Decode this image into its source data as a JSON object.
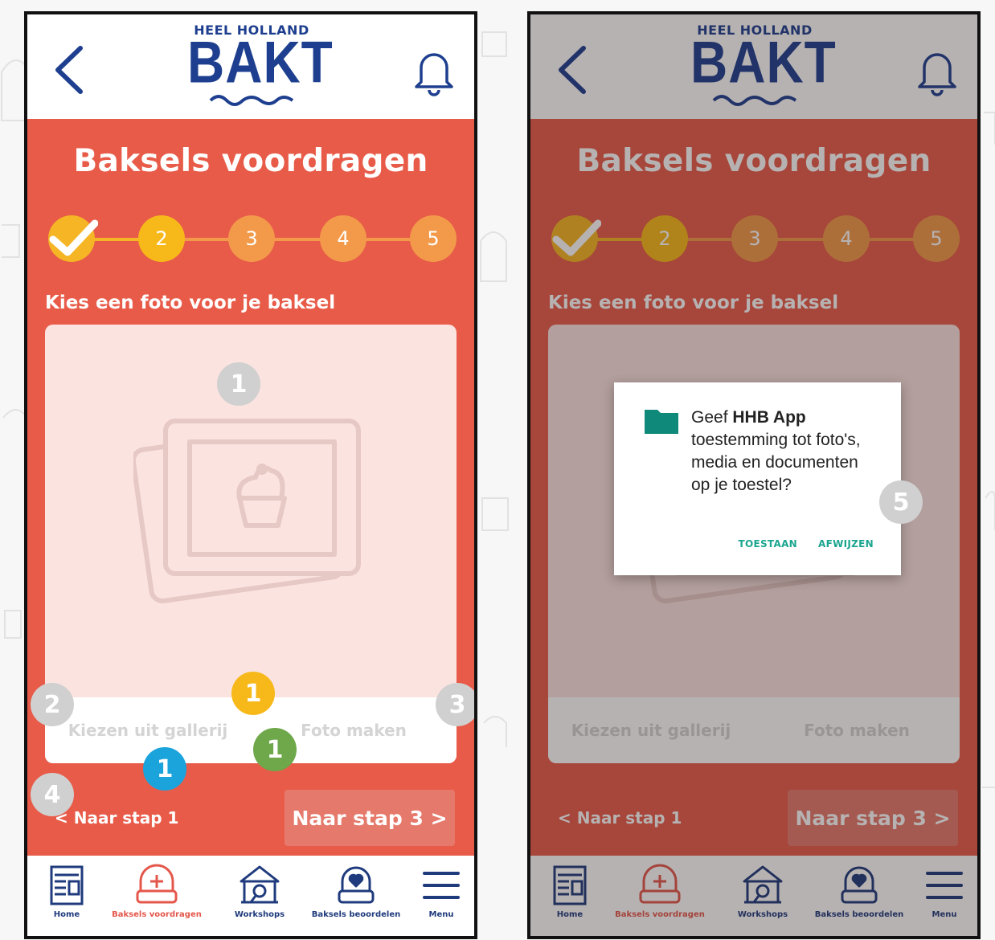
{
  "app": {
    "logo_top": "HEEL HOLLAND",
    "logo_main": "BAKT"
  },
  "page_title": "Baksels voordragen",
  "steps": [
    "2",
    "3",
    "4",
    "5"
  ],
  "photo_label": "Kies een foto voor je baksel",
  "card_buttons": {
    "gallery": "Kiezen uit gallerij",
    "camera": "Foto maken"
  },
  "nav": {
    "prev": "< Naar stap 1",
    "next": "Naar stap 3 >"
  },
  "tabs": [
    {
      "label": "Home",
      "icon": "newspaper-icon"
    },
    {
      "label": "Baksels voordragen",
      "icon": "oven-mitt-plus-icon"
    },
    {
      "label": "Workshops",
      "icon": "tent-icon"
    },
    {
      "label": "Baksels beoordelen",
      "icon": "oven-mitt-heart-icon"
    },
    {
      "label": "Menu",
      "icon": "hamburger-icon"
    }
  ],
  "dialog": {
    "prefix": "Geef ",
    "app_name": "HHB App",
    "message": " toestemming tot foto's, media en documenten op je toestel?",
    "allow": "TOESTAAN",
    "deny": "AFWIJZEN"
  },
  "annotations": {
    "card": "1",
    "yellow": "1",
    "green": "1",
    "blue": "1",
    "gallery": "2",
    "camera": "3",
    "prev": "4",
    "dialog": "5"
  },
  "colors": {
    "brand_red": "#e85b49",
    "logo_blue": "#1e3f8f",
    "step_done": "#f5b524",
    "step_active": "#f7b91a",
    "step_future": "#f29a4a",
    "dialog_accent": "#1aa58f"
  }
}
